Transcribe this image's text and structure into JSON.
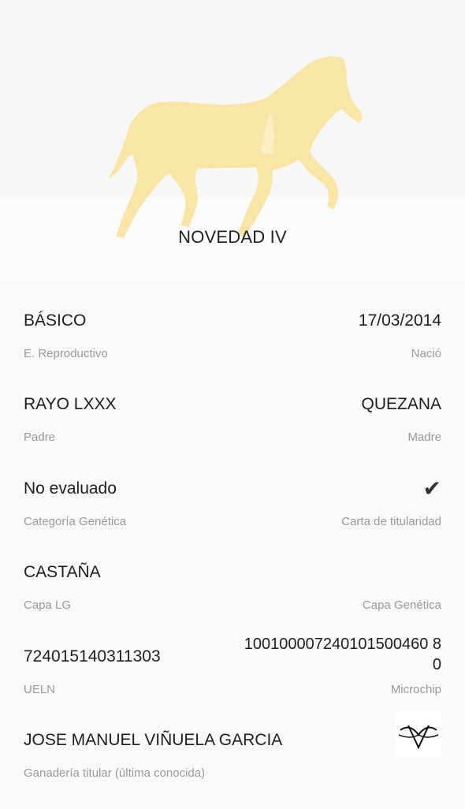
{
  "header": {
    "horse_name": "NOVEDAD IV",
    "horse_image_icon": "horse-silhouette-icon",
    "horse_color": "#f9e6a6"
  },
  "fields": {
    "reproductive_state": {
      "value": "BÁSICO",
      "label": "E. Reproductivo"
    },
    "birth_date": {
      "value": "17/03/2014",
      "label": "Nació"
    },
    "father": {
      "value": "RAYO LXXX",
      "label": "Padre"
    },
    "mother": {
      "value": "QUEZANA",
      "label": "Madre"
    },
    "genetic_category": {
      "value": "No evaluado",
      "label": "Categoría Genética"
    },
    "ownership_card": {
      "icon": "checkmark-icon",
      "label": "Carta de titularidad"
    },
    "coat_lg": {
      "value": "CASTAÑA",
      "label": "Capa LG"
    },
    "coat_genetic": {
      "value": "",
      "label": "Capa Genética"
    },
    "ueln": {
      "value": "724015140311303",
      "label": "UELN"
    },
    "microchip": {
      "value": "100100007240101500460 80",
      "label": "Microchip"
    },
    "owner_farm": {
      "value": "JOSE MANUEL VIÑUELA GARCIA",
      "label": "Ganadería titular (última conocida)",
      "logo_icon": "brand-mark-icon"
    }
  }
}
